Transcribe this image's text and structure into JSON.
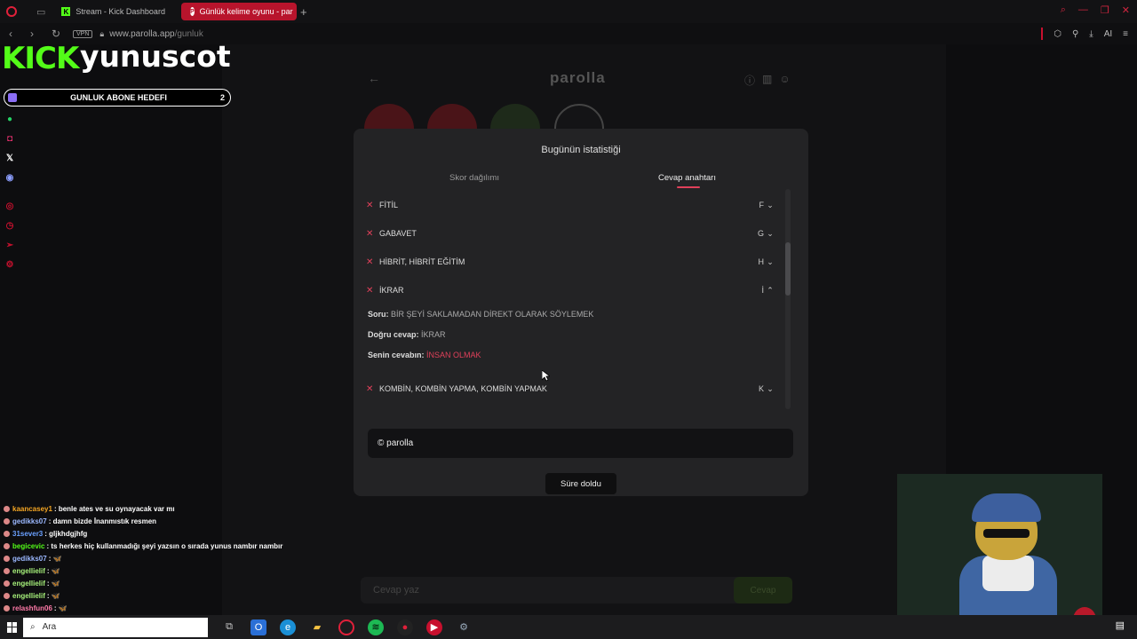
{
  "browser": {
    "tabs": [
      {
        "title": "Stream - Kick Dashboard"
      },
      {
        "title": "Günlük kelime oyunu - par"
      }
    ],
    "new_tab": "+",
    "vpn": "VPN",
    "url_host": "www.parolla.app",
    "url_path": "/gunluk",
    "ai_label": "AI"
  },
  "overlay": {
    "brand": "KICK",
    "channel": "yunuscot",
    "goal_label": "GUNLUK ABONE HEDEFI",
    "goal_count": "2"
  },
  "game_bg": {
    "title": "parolla",
    "input_placeholder": "Cevap yaz",
    "submit_label": "Cevap"
  },
  "modal": {
    "title": "Bugünün istatistiği",
    "tab_scores": "Skor dağılımı",
    "tab_answers": "Cevap anahtarı",
    "rows": [
      {
        "word": "FİTİL",
        "letter": "F",
        "chevron": "⌄"
      },
      {
        "word": "GABAVET",
        "letter": "G",
        "chevron": "⌄"
      },
      {
        "word": "HİBRİT, HİBRİT EĞİTİM",
        "letter": "H",
        "chevron": "⌄"
      },
      {
        "word": "İKRAR",
        "letter": "İ",
        "chevron": "⌃"
      },
      {
        "word": "KOMBİN, KOMBİN YAPMA, KOMBİN YAPMAK",
        "letter": "K",
        "chevron": "⌄"
      }
    ],
    "detail": {
      "q_label": "Soru:",
      "q_text": "BİR ŞEYİ SAKLAMADAN DİREKT OLARAK SÖYLEMEK",
      "a_label": "Doğru cevap:",
      "a_text": "İKRAR",
      "y_label": "Senin cevabın:",
      "y_text": "İNSAN OLMAK"
    },
    "share_text": "© parolla",
    "timeup_label": "Süre doldu"
  },
  "chat": [
    {
      "user": "kaancasey1",
      "text": ": benle ates ve su oynayacak var mı",
      "color": "#f5a623"
    },
    {
      "user": "gedikks07",
      "text": ": damn bizde İnanmıstık resmen",
      "color": "#9bb8ff"
    },
    {
      "user": "31sever3",
      "text": ": gljkhdgjhfg",
      "color": "#6aa0ff"
    },
    {
      "user": "begicevic",
      "text": ": ts herkes hiç kullanmadığı şeyi yazsın o sırada yunus nambır nambır",
      "color": "#53fc18"
    },
    {
      "user": "gedikks07",
      "text": ": 🦋",
      "color": "#9bb8ff"
    },
    {
      "user": "engellielif",
      "text": ": 🦋",
      "color": "#a6f07a"
    },
    {
      "user": "engellielif",
      "text": ": 🦋",
      "color": "#a6f07a"
    },
    {
      "user": "engellielif",
      "text": ": 🦋",
      "color": "#a6f07a"
    },
    {
      "user": "relashfun06",
      "text": ": 🦋",
      "color": "#ff7aa8"
    }
  ],
  "taskbar": {
    "search_placeholder": "Ara"
  },
  "colors": {
    "accent": "#e0405a",
    "kick_green": "#53fc18",
    "tab_active": "#b8142c"
  }
}
